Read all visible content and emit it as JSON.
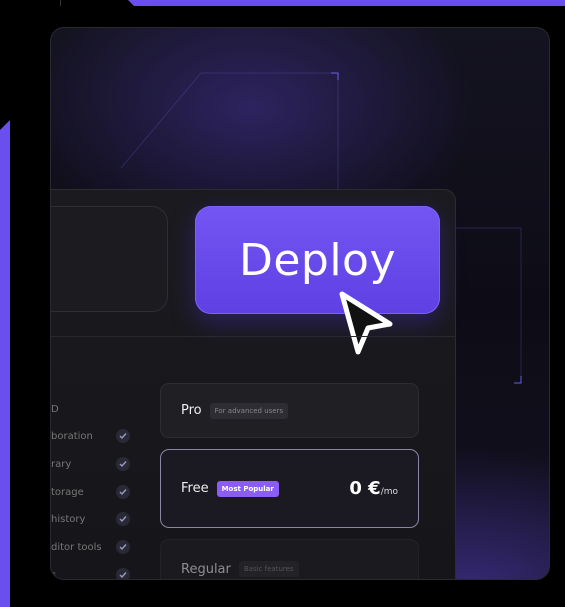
{
  "deploy": {
    "label": "Deploy"
  },
  "features": [
    {
      "label": "D"
    },
    {
      "label": "boration"
    },
    {
      "label": "rary"
    },
    {
      "label": "torage"
    },
    {
      "label": "history"
    },
    {
      "label": "ditor tools"
    },
    {
      "label": "s"
    }
  ],
  "plans": [
    {
      "name": "Pro",
      "tag": "For advanced users"
    },
    {
      "name": "Free",
      "tag": "Most Popular",
      "price": "0 €",
      "unit": "/mo"
    },
    {
      "name": "Regular",
      "tag": "Basic features"
    }
  ],
  "colors": {
    "accent": "#6a4ef0",
    "button": "#6549ec",
    "popular_badge": "#8b5cf6"
  },
  "icons": [
    "cursor-icon",
    "check-icon"
  ]
}
